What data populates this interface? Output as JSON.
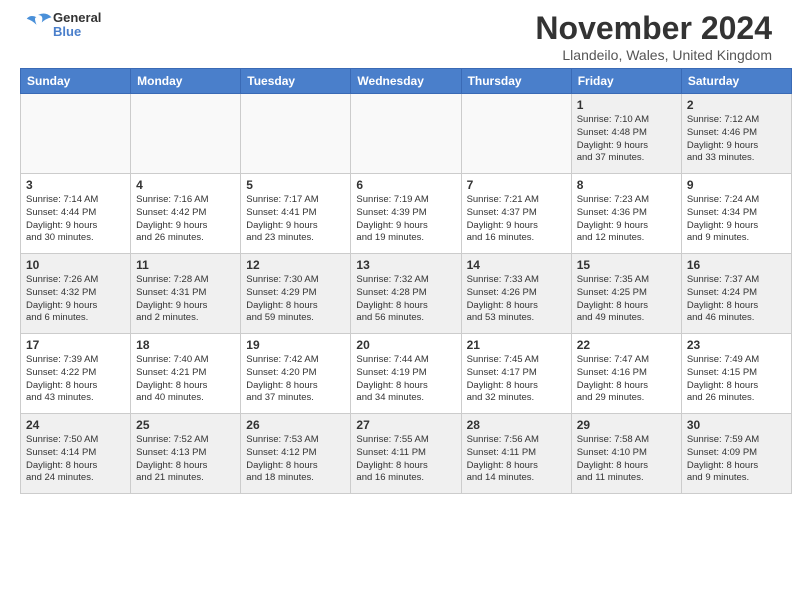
{
  "header": {
    "logo_text1": "General",
    "logo_text2": "Blue",
    "month": "November 2024",
    "location": "Llandeilo, Wales, United Kingdom"
  },
  "weekdays": [
    "Sunday",
    "Monday",
    "Tuesday",
    "Wednesday",
    "Thursday",
    "Friday",
    "Saturday"
  ],
  "weeks": [
    [
      {
        "day": "",
        "info": ""
      },
      {
        "day": "",
        "info": ""
      },
      {
        "day": "",
        "info": ""
      },
      {
        "day": "",
        "info": ""
      },
      {
        "day": "",
        "info": ""
      },
      {
        "day": "1",
        "info": "Sunrise: 7:10 AM\nSunset: 4:48 PM\nDaylight: 9 hours\nand 37 minutes."
      },
      {
        "day": "2",
        "info": "Sunrise: 7:12 AM\nSunset: 4:46 PM\nDaylight: 9 hours\nand 33 minutes."
      }
    ],
    [
      {
        "day": "3",
        "info": "Sunrise: 7:14 AM\nSunset: 4:44 PM\nDaylight: 9 hours\nand 30 minutes."
      },
      {
        "day": "4",
        "info": "Sunrise: 7:16 AM\nSunset: 4:42 PM\nDaylight: 9 hours\nand 26 minutes."
      },
      {
        "day": "5",
        "info": "Sunrise: 7:17 AM\nSunset: 4:41 PM\nDaylight: 9 hours\nand 23 minutes."
      },
      {
        "day": "6",
        "info": "Sunrise: 7:19 AM\nSunset: 4:39 PM\nDaylight: 9 hours\nand 19 minutes."
      },
      {
        "day": "7",
        "info": "Sunrise: 7:21 AM\nSunset: 4:37 PM\nDaylight: 9 hours\nand 16 minutes."
      },
      {
        "day": "8",
        "info": "Sunrise: 7:23 AM\nSunset: 4:36 PM\nDaylight: 9 hours\nand 12 minutes."
      },
      {
        "day": "9",
        "info": "Sunrise: 7:24 AM\nSunset: 4:34 PM\nDaylight: 9 hours\nand 9 minutes."
      }
    ],
    [
      {
        "day": "10",
        "info": "Sunrise: 7:26 AM\nSunset: 4:32 PM\nDaylight: 9 hours\nand 6 minutes."
      },
      {
        "day": "11",
        "info": "Sunrise: 7:28 AM\nSunset: 4:31 PM\nDaylight: 9 hours\nand 2 minutes."
      },
      {
        "day": "12",
        "info": "Sunrise: 7:30 AM\nSunset: 4:29 PM\nDaylight: 8 hours\nand 59 minutes."
      },
      {
        "day": "13",
        "info": "Sunrise: 7:32 AM\nSunset: 4:28 PM\nDaylight: 8 hours\nand 56 minutes."
      },
      {
        "day": "14",
        "info": "Sunrise: 7:33 AM\nSunset: 4:26 PM\nDaylight: 8 hours\nand 53 minutes."
      },
      {
        "day": "15",
        "info": "Sunrise: 7:35 AM\nSunset: 4:25 PM\nDaylight: 8 hours\nand 49 minutes."
      },
      {
        "day": "16",
        "info": "Sunrise: 7:37 AM\nSunset: 4:24 PM\nDaylight: 8 hours\nand 46 minutes."
      }
    ],
    [
      {
        "day": "17",
        "info": "Sunrise: 7:39 AM\nSunset: 4:22 PM\nDaylight: 8 hours\nand 43 minutes."
      },
      {
        "day": "18",
        "info": "Sunrise: 7:40 AM\nSunset: 4:21 PM\nDaylight: 8 hours\nand 40 minutes."
      },
      {
        "day": "19",
        "info": "Sunrise: 7:42 AM\nSunset: 4:20 PM\nDaylight: 8 hours\nand 37 minutes."
      },
      {
        "day": "20",
        "info": "Sunrise: 7:44 AM\nSunset: 4:19 PM\nDaylight: 8 hours\nand 34 minutes."
      },
      {
        "day": "21",
        "info": "Sunrise: 7:45 AM\nSunset: 4:17 PM\nDaylight: 8 hours\nand 32 minutes."
      },
      {
        "day": "22",
        "info": "Sunrise: 7:47 AM\nSunset: 4:16 PM\nDaylight: 8 hours\nand 29 minutes."
      },
      {
        "day": "23",
        "info": "Sunrise: 7:49 AM\nSunset: 4:15 PM\nDaylight: 8 hours\nand 26 minutes."
      }
    ],
    [
      {
        "day": "24",
        "info": "Sunrise: 7:50 AM\nSunset: 4:14 PM\nDaylight: 8 hours\nand 24 minutes."
      },
      {
        "day": "25",
        "info": "Sunrise: 7:52 AM\nSunset: 4:13 PM\nDaylight: 8 hours\nand 21 minutes."
      },
      {
        "day": "26",
        "info": "Sunrise: 7:53 AM\nSunset: 4:12 PM\nDaylight: 8 hours\nand 18 minutes."
      },
      {
        "day": "27",
        "info": "Sunrise: 7:55 AM\nSunset: 4:11 PM\nDaylight: 8 hours\nand 16 minutes."
      },
      {
        "day": "28",
        "info": "Sunrise: 7:56 AM\nSunset: 4:11 PM\nDaylight: 8 hours\nand 14 minutes."
      },
      {
        "day": "29",
        "info": "Sunrise: 7:58 AM\nSunset: 4:10 PM\nDaylight: 8 hours\nand 11 minutes."
      },
      {
        "day": "30",
        "info": "Sunrise: 7:59 AM\nSunset: 4:09 PM\nDaylight: 8 hours\nand 9 minutes."
      }
    ]
  ]
}
